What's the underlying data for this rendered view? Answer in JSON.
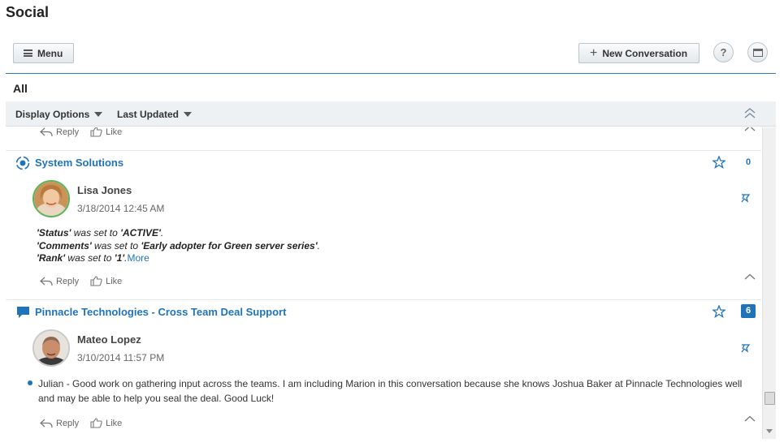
{
  "app": {
    "title": "Social"
  },
  "header": {
    "menu_label": "Menu",
    "new_conversation_label": "New Conversation",
    "help_label": "?"
  },
  "filter": {
    "title": "All",
    "display_options_label": "Display Options",
    "sort_label": "Last Updated"
  },
  "actions": {
    "reply_label": "Reply",
    "like_label": "Like"
  },
  "conversations": [
    {
      "title": "System Solutions",
      "count": "0",
      "author": "Lisa Jones",
      "timestamp": "3/18/2014 12:45 AM",
      "changes": [
        {
          "field": "'Status'",
          "text": " was set to ",
          "value": "'ACTIVE'",
          "end": "."
        },
        {
          "field": "'Comments'",
          "text": " was set to ",
          "value": "'Early adopter for Green server series'",
          "end": "."
        },
        {
          "field": "'Rank'",
          "text": " was set to ",
          "value": "'1'",
          "end": "."
        }
      ],
      "more_label": "More"
    },
    {
      "title": "Pinnacle Technologies - Cross Team Deal Support",
      "count": "6",
      "author": "Mateo Lopez",
      "timestamp": "3/10/2014 11:57 PM",
      "message": "Julian - Good work on gathering input across the teams. I am including Marion in this conversation because she knows Joshua Baker at Pinnacle Technologies well and may be able to help you seal the deal. Good Luck!"
    }
  ],
  "colors": {
    "accent": "#1f74b9",
    "online": "#58b55a"
  },
  "icons": [
    "menu-icon",
    "plus-icon",
    "help-icon",
    "window-icon",
    "caret-down-icon",
    "collapse-all-icon",
    "reply-icon",
    "like-icon",
    "record-icon",
    "conversation-icon",
    "star-icon",
    "pin-icon",
    "chevron-up-icon"
  ]
}
